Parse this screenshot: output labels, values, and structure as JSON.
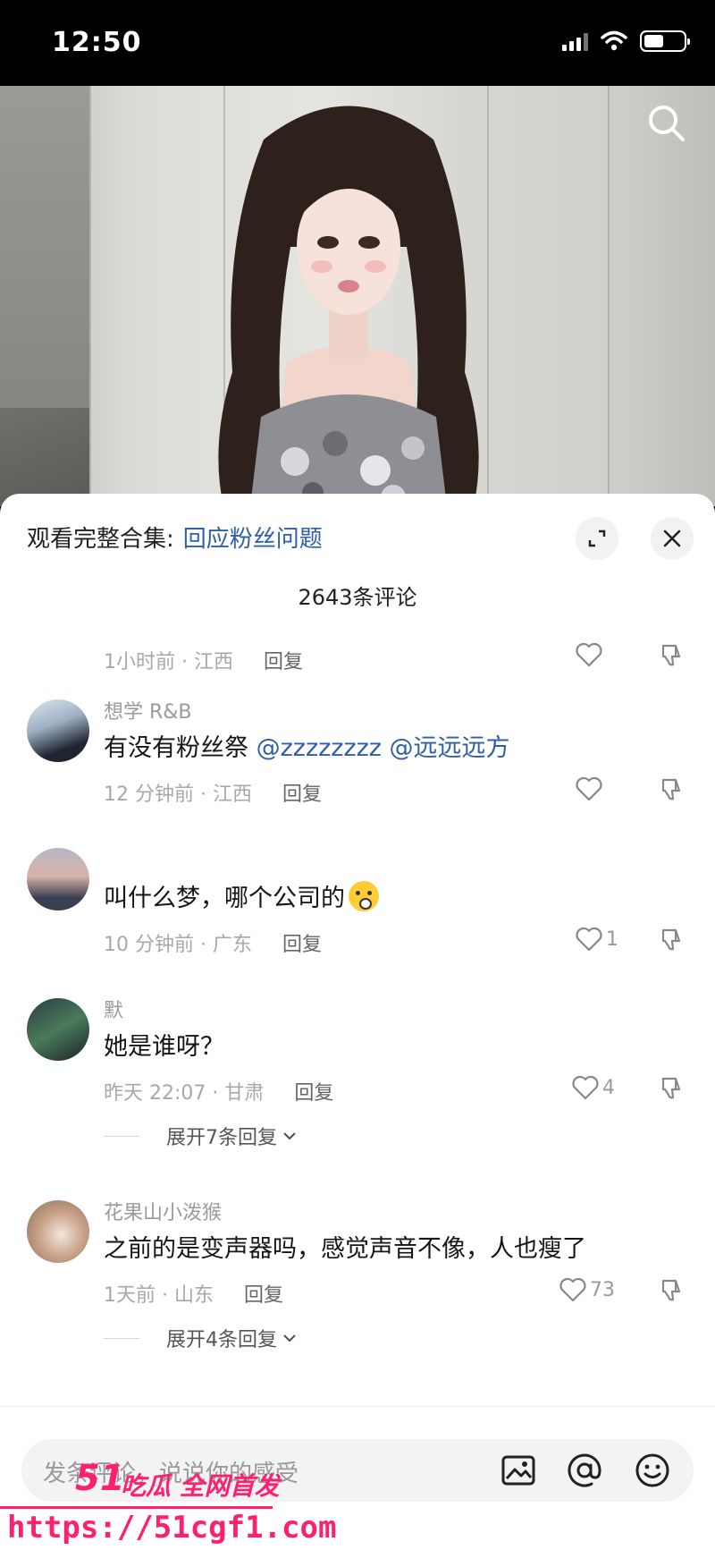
{
  "status": {
    "time": "12:50"
  },
  "header": {
    "collection_label": "观看完整合集:",
    "collection_link": "回应粉丝问题",
    "comment_count": "2643条评论"
  },
  "comments": [
    {
      "user": "",
      "text": "",
      "time_location": "1小时前 · 江西",
      "reply": "回复",
      "likes": ""
    },
    {
      "user": "想学 R&B",
      "text": "有没有粉丝祭 ",
      "mentions": "@zzzzzzzz @远远远方",
      "time_location": "12 分钟前 · 江西",
      "reply": "回复",
      "likes": ""
    },
    {
      "user": "",
      "text": "叫什么梦，哪个公司的",
      "time_location": "10 分钟前 · 广东",
      "reply": "回复",
      "likes": "1"
    },
    {
      "user": "默",
      "text": "她是谁呀？",
      "time_location": "昨天 22:07 · 甘肃",
      "reply": "回复",
      "likes": "4",
      "expand": "展开7条回复"
    },
    {
      "user": "花果山小泼猴",
      "text": "之前的是变声器吗，感觉声音不像，人也瘦了",
      "time_location": "1天前 · 山东",
      "reply": "回复",
      "likes": "73",
      "expand": "展开4条回复"
    }
  ],
  "input": {
    "placeholder": "发条评论，说说你的感受"
  },
  "watermark": {
    "brand": "51",
    "slogan": "吃瓜 全网首发",
    "url": "https://51cgf1.com"
  },
  "icons": [
    "search-icon",
    "expand-icon",
    "close-icon",
    "heart-icon",
    "thumbs-down-icon",
    "image-icon",
    "at-icon",
    "emoji-icon"
  ],
  "colors": {
    "link": "#2f5fa8",
    "watermark": "#ff1f6f"
  }
}
